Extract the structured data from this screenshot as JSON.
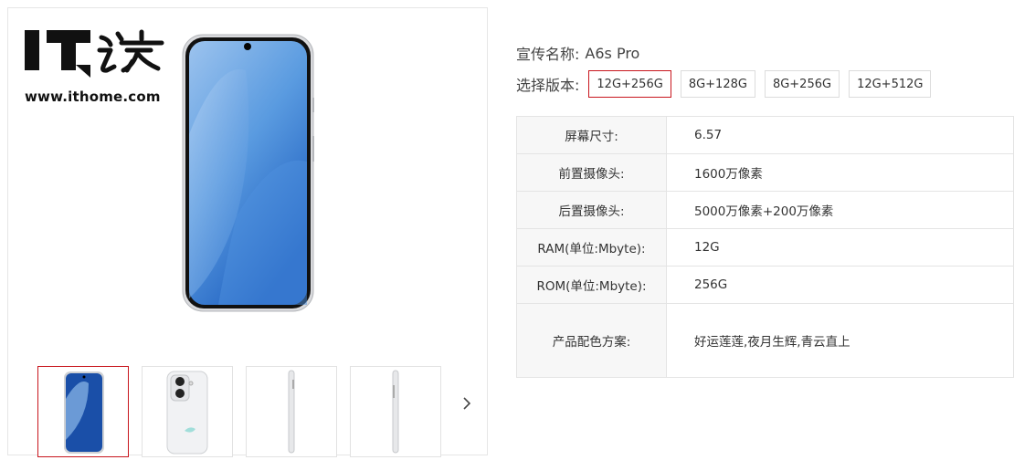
{
  "logo": {
    "brand_text": "IT之家",
    "url": "www.ithome.com"
  },
  "product": {
    "name_label": "宣传名称:",
    "name_value": "A6s Pro",
    "version_label": "选择版本:",
    "versions": [
      "12G+256G",
      "8G+128G",
      "8G+256G",
      "12G+512G"
    ],
    "selected_version": "12G+256G"
  },
  "specs": [
    {
      "key": "屏幕尺寸:",
      "value": "6.57"
    },
    {
      "key": "前置摄像头:",
      "value": "1600万像素"
    },
    {
      "key": "后置摄像头:",
      "value": "5000万像素+200万像素"
    },
    {
      "key": "RAM(单位:Mbyte):",
      "value": "12G"
    },
    {
      "key": "ROM(单位:Mbyte):",
      "value": "256G"
    },
    {
      "key": "产品配色方案:",
      "value": "好运莲莲,夜月生辉,青云直上"
    }
  ],
  "gallery": {
    "thumbnails": [
      "front-blue",
      "back-white",
      "side-left",
      "side-right"
    ],
    "active_index": 0,
    "next_icon": "chevron-right-icon"
  },
  "colors": {
    "accent": "#c8161d",
    "border": "#e4e4e4",
    "key_bg": "#f7f7f7"
  }
}
